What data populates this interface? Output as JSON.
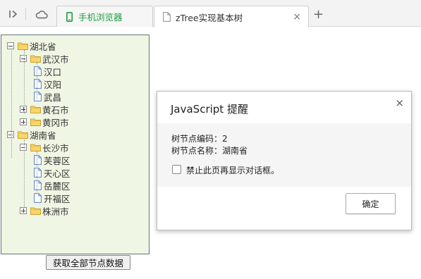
{
  "browser": {
    "tabs": [
      {
        "label": "手机浏览器",
        "icon": "phone-icon",
        "color": "#1d9e3e"
      },
      {
        "label": "zTree实现基本树",
        "icon": "page-icon",
        "active": true
      }
    ],
    "close_glyph": "×",
    "new_tab_glyph": "+"
  },
  "tree": {
    "nodes": [
      {
        "label": "湖北省",
        "type": "folder",
        "state": "open",
        "level": 0
      },
      {
        "label": "武汉市",
        "type": "folder",
        "state": "open",
        "level": 1
      },
      {
        "label": "汉口",
        "type": "leaf",
        "level": 2
      },
      {
        "label": "汉阳",
        "type": "leaf",
        "level": 2
      },
      {
        "label": "武昌",
        "type": "leaf",
        "level": 2
      },
      {
        "label": "黄石市",
        "type": "folder",
        "state": "closed",
        "level": 1
      },
      {
        "label": "黄冈市",
        "type": "folder",
        "state": "closed",
        "level": 1
      },
      {
        "label": "湖南省",
        "type": "folder",
        "state": "open",
        "level": 0
      },
      {
        "label": "长沙市",
        "type": "folder",
        "state": "open",
        "level": 1
      },
      {
        "label": "芙蓉区",
        "type": "leaf",
        "level": 2
      },
      {
        "label": "天心区",
        "type": "leaf",
        "level": 2
      },
      {
        "label": "岳麓区",
        "type": "leaf",
        "level": 2
      },
      {
        "label": "开福区",
        "type": "leaf",
        "level": 2
      },
      {
        "label": "株洲市",
        "type": "folder",
        "state": "closed",
        "level": 1
      }
    ]
  },
  "get_all_button": "获取全部节点数据",
  "dialog": {
    "title": "JavaScript 提醒",
    "line1": "树节点编码：2",
    "line2": "树节点名称：湖南省",
    "checkbox_label": "禁止此页再显示对话框。",
    "ok_label": "确定",
    "close_glyph": "×"
  }
}
